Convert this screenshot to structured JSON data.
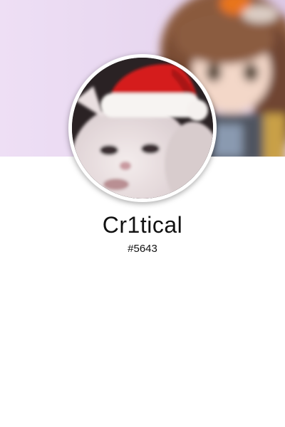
{
  "profile": {
    "username": "Cr1tical",
    "discriminator": "#5643"
  },
  "banner": {
    "image": "anime-character-banner",
    "background_color": "#eadcf3"
  },
  "avatar": {
    "image": "cat-with-santa-hat",
    "ring_color": "#ffffff"
  }
}
